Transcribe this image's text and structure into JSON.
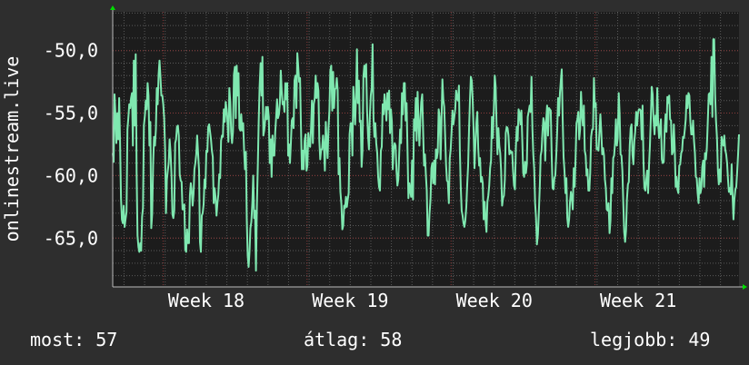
{
  "chart_data": {
    "type": "line",
    "ylabel": "onlinestream.live",
    "x_ticks": [
      "Week 18",
      "Week 19",
      "Week 20",
      "Week 21"
    ],
    "y_ticks": [
      "-50,0",
      "-55,0",
      "-60,0",
      "-65,0"
    ],
    "y_tick_values": [
      -50,
      -55,
      -60,
      -65
    ],
    "ylim": [
      -68.9,
      -46.9
    ],
    "xlim_weeks": [
      17.35,
      21.7
    ],
    "x_tick_values": [
      18,
      19,
      20,
      21
    ],
    "grid": true,
    "series": [
      {
        "color": "#7fe8b0",
        "x_start_week": 17.35,
        "x_end_week": 21.7,
        "values": [
          -58.2,
          -58.9,
          -53.5,
          -55.1,
          -57.4,
          -55.0,
          -57.1,
          -53.8,
          -57.4,
          -61.8,
          -63.5,
          -63.8,
          -62.4,
          -64.1,
          -63.5,
          -62.9,
          -56.3,
          -55.4,
          -54.3,
          -54.6,
          -53.8,
          -53.4,
          -57.6,
          -50.8,
          -56.0,
          -50.3,
          -59.7,
          -64.8,
          -65.7,
          -66.1,
          -65.4,
          -66.0,
          -63.3,
          -62.6,
          -56.0,
          -55.2,
          -54.0,
          -54.7,
          -52.6,
          -53.6,
          -57.6,
          -55.7,
          -64.2,
          -63.1,
          -59.0,
          -56.9,
          -57.6,
          -56.3,
          -53.0,
          -54.3,
          -51.9,
          -50.8,
          -52.1,
          -53.6,
          -53.6,
          -54.3,
          -55.4,
          -57.8,
          -63.0,
          -60.3,
          -59.6,
          -59.0,
          -57.1,
          -58.1,
          -60.0,
          -63.1,
          -63.4,
          -62.8,
          -57.4,
          -57.1,
          -56.1,
          -56.0,
          -56.8,
          -59.9,
          -60.4,
          -60.5,
          -62.7,
          -62.7,
          -62.3,
          -65.9,
          -66.1,
          -64.3,
          -65.4,
          -65.4,
          -61.6,
          -60.6,
          -61.2,
          -62.4,
          -61.5,
          -59.5,
          -59.0,
          -58.3,
          -56.8,
          -58.3,
          -59.6,
          -65.3,
          -66.1,
          -63.2,
          -63.0,
          -62.3,
          -60.3,
          -61.0,
          -58.0,
          -58.1,
          -56.1,
          -55.9,
          -56.5,
          -57.1,
          -58.0,
          -58.5,
          -62.2,
          -61.0,
          -61.7,
          -63.2,
          -62.2,
          -61.5,
          -59.9,
          -60.2,
          -57.2,
          -56.8,
          -56.9,
          -54.7,
          -55.7,
          -54.1,
          -54.7,
          -55.8,
          -57.3,
          -53.0,
          -54.1,
          -56.5,
          -57.4,
          -56.5,
          -51.9,
          -51.3,
          -55.4,
          -51.2,
          -53.6,
          -51.8,
          -56.2,
          -56.4,
          -55.1,
          -56.4,
          -55.8,
          -57.9,
          -59.5,
          -58.1,
          -63.5,
          -66.4,
          -67.3,
          -66.1,
          -64.2,
          -63.7,
          -62.2,
          -60.0,
          -63.4,
          -62.8,
          -67.6,
          -62.5,
          -59.3,
          -55.7,
          -52.9,
          -51.0,
          -53.6,
          -50.5,
          -56.8,
          -56.4,
          -55.6,
          -54.5,
          -55.5,
          -54.5,
          -55.3,
          -59.0,
          -57.1,
          -60.1,
          -56.8,
          -58.4,
          -58.4,
          -56.5,
          -55.3,
          -53.9,
          -55.4,
          -55.1,
          -54.2,
          -51.6,
          -53.2,
          -54.3,
          -54.1,
          -54.9,
          -52.6,
          -53.9,
          -52.6,
          -58.4,
          -57.5,
          -59.0,
          -57.4,
          -55.6,
          -55.4,
          -56.2,
          -52.4,
          -52.0,
          -54.6,
          -50.2,
          -51.3,
          -52.5,
          -52.2,
          -56.1,
          -59.5,
          -58.0,
          -59.5,
          -57.2,
          -56.7,
          -59.6,
          -59.2,
          -56.6,
          -57.6,
          -57.7,
          -56.2,
          -54.0,
          -57.4,
          -54.3,
          -53.8,
          -52.0,
          -53.8,
          -52.6,
          -53.2,
          -57.2,
          -58.7,
          -57.9,
          -57.9,
          -56.8,
          -57.7,
          -59.6,
          -55.7,
          -57.3,
          -58.6,
          -56.2,
          -54.8,
          -51.6,
          -51.2,
          -54.8,
          -51.7,
          -54.6,
          -53.1,
          -53.0,
          -52.2,
          -53.2,
          -59.9,
          -58.6,
          -61.3,
          -62.3,
          -64.3,
          -64.0,
          -62.4,
          -62.6,
          -61.7,
          -62.5,
          -61.9,
          -61.4,
          -56.7,
          -55.8,
          -55.8,
          -58.4,
          -52.9,
          -54.3,
          -55.9,
          -53.6,
          -49.9,
          -54.2,
          -52.4,
          -55.7,
          -55.6,
          -59.3,
          -58.0,
          -52.1,
          -51.2,
          -52.1,
          -51.1,
          -54.8,
          -56.8,
          -57.9,
          -55.2,
          -53.6,
          -53.0,
          -49.5,
          -55.4,
          -56.9,
          -55.8,
          -57.4,
          -58.2,
          -60.1,
          -60.9,
          -61.2,
          -58.0,
          -57.7,
          -54.3,
          -55.1,
          -53.5,
          -54.3,
          -55.6,
          -53.4,
          -54.7,
          -53.2,
          -56.6,
          -54.7,
          -55.7,
          -59.5,
          -57.9,
          -57.4,
          -57.6,
          -59.6,
          -60.8,
          -60.3,
          -58.2,
          -56.3,
          -57.4,
          -53.4,
          -55.1,
          -52.6,
          -52.6,
          -55.6,
          -54.2,
          -57.9,
          -61.8,
          -60.6,
          -61.2,
          -61.7,
          -58.8,
          -61.9,
          -55.5,
          -56.4,
          -53.8,
          -57.2,
          -53.3,
          -55.6,
          -57.6,
          -55.6,
          -54.1,
          -53.5,
          -56.5,
          -59.2,
          -58.3,
          -59.9,
          -61.2,
          -64.8,
          -64.8,
          -63.1,
          -61.9,
          -59.4,
          -59.0,
          -60.6,
          -58.8,
          -60.7,
          -57.9,
          -58.6,
          -58.1,
          -54.7,
          -55.3,
          -58.7,
          -55.8,
          -52.3,
          -53.9,
          -54.5,
          -56.8,
          -59.1,
          -60.4,
          -60.5,
          -62.2,
          -58.6,
          -57.9,
          -56.5,
          -54.8,
          -55.9,
          -55.3,
          -54.7,
          -53.2,
          -53.8,
          -54.0,
          -52.8,
          -58.0,
          -60.9,
          -62.8,
          -63.2,
          -63.8,
          -64.1,
          -63.6,
          -62.5,
          -60.7,
          -59.2,
          -56.3,
          -54.0,
          -52.1,
          -52.4,
          -53.9,
          -56.3,
          -59.4,
          -57.4,
          -55.7,
          -54.9,
          -57.8,
          -59.2,
          -58.6,
          -60.5,
          -60.1,
          -60.6,
          -63.5,
          -62.1,
          -63.6,
          -64.5,
          -62.1,
          -61.6,
          -60.8,
          -59.4,
          -58.8,
          -55.3,
          -57.0,
          -54.7,
          -52.0,
          -52.9,
          -56.0,
          -58.3,
          -56.2,
          -57.6,
          -58.2,
          -59.6,
          -62.4,
          -61.8,
          -61.6,
          -60.3,
          -56.6,
          -56.1,
          -56.2,
          -56.8,
          -58.3,
          -58.0,
          -58.2,
          -58.1,
          -59.7,
          -60.8,
          -61.1,
          -57.8,
          -56.1,
          -57.2,
          -54.7,
          -55.0,
          -55.9,
          -54.8,
          -57.2,
          -59.8,
          -60.1,
          -58.9,
          -59.8,
          -59.1,
          -55.3,
          -54.9,
          -54.4,
          -54.9,
          -52.1,
          -56.2,
          -58.3,
          -59.5,
          -62.2,
          -63.4,
          -65.5,
          -64.7,
          -62.9,
          -61.0,
          -58.4,
          -58.0,
          -56.5,
          -55.4,
          -55.8,
          -58.8,
          -55.7,
          -54.4,
          -56.8,
          -54.6,
          -54.7,
          -54.8,
          -58.3,
          -61.0,
          -61.1,
          -60.2,
          -60.0,
          -58.3,
          -56.4,
          -53.8,
          -55.2,
          -53.4,
          -52.4,
          -51.5,
          -55.4,
          -58.5,
          -59.6,
          -61.4,
          -60.2,
          -63.4,
          -64.1,
          -63.5,
          -62.1,
          -61.3,
          -61.8,
          -62.7,
          -59.4,
          -60.9,
          -58.6,
          -55.8,
          -55.5,
          -54.9,
          -57.1,
          -56.3,
          -53.3,
          -55.1,
          -56.0,
          -54.4,
          -58.0,
          -58.4,
          -60.0,
          -59.5,
          -61.2,
          -61.2,
          -59.8,
          -56.9,
          -56.3,
          -56.3,
          -52.2,
          -54.5,
          -54.2,
          -57.9,
          -57.8,
          -58.0,
          -56.6,
          -55.1,
          -56.5,
          -58.3,
          -57.8,
          -58.4,
          -60.3,
          -61.0,
          -62.7,
          -62.8,
          -62.2,
          -64.6,
          -63.6,
          -60.2,
          -61.4,
          -58.6,
          -58.4,
          -57.4,
          -55.5,
          -57.6,
          -57.0,
          -53.4,
          -55.1,
          -58.3,
          -58.4,
          -59.6,
          -62.2,
          -64.5,
          -65.3,
          -64.4,
          -61.9,
          -60.7,
          -60.5,
          -57.6,
          -56.2,
          -55.9,
          -58.3,
          -59.1,
          -57.3,
          -56.5,
          -54.9,
          -56.0,
          -55.0,
          -54.7,
          -54.7,
          -54.8,
          -57.1,
          -54.4,
          -58.8,
          -61.0,
          -61.2,
          -60.3,
          -59.6,
          -61.4,
          -59.2,
          -57.6,
          -55.4,
          -52.9,
          -53.5,
          -55.5,
          -56.7,
          -55.2,
          -56.0,
          -53.0,
          -55.9,
          -57.0,
          -56.1,
          -55.5,
          -58.7,
          -59.0,
          -58.9,
          -56.4,
          -55.1,
          -56.5,
          -53.7,
          -54.2,
          -53.6,
          -55.5,
          -55.6,
          -58.3,
          -58.1,
          -55.9,
          -57.8,
          -60.9,
          -60.1,
          -61.1,
          -61.4,
          -59.2,
          -59.1,
          -58.2,
          -58.0,
          -56.9,
          -57.0,
          -56.3,
          -55.5,
          -53.6,
          -54.6,
          -53.4,
          -53.6,
          -55.7,
          -56.7,
          -56.7,
          -55.6,
          -57.2,
          -58.2,
          -60.1,
          -60.2,
          -61.4,
          -62.2,
          -60.2,
          -61.4,
          -61.0,
          -59.3,
          -58.8,
          -60.9,
          -58.2,
          -58.7,
          -57.8,
          -55.6,
          -53.5,
          -53.4,
          -54.3,
          -50.5,
          -55.3,
          -49.1,
          -49.1,
          -53.5,
          -55.6,
          -57.0,
          -59.6,
          -60.7,
          -59.5,
          -60.5,
          -56.9,
          -57.4,
          -57.6,
          -56.8,
          -57.9,
          -58.3,
          -59.0,
          -60.3,
          -61.3,
          -61.0,
          -61.5,
          -59.1,
          -61.5,
          -63.5,
          -61.9,
          -61.1,
          -60.9,
          -59.7,
          -58.3,
          -56.7
        ]
      }
    ],
    "arrow_color": "#00dd00",
    "grid_color": "#5a5a5a",
    "week_grid_color": "#8a3a3a"
  },
  "stats": {
    "now_label": "most:",
    "now_value": "57",
    "avg_label": "átlag:",
    "avg_value": "58",
    "best_label": "legjobb:",
    "best_value": "49"
  }
}
